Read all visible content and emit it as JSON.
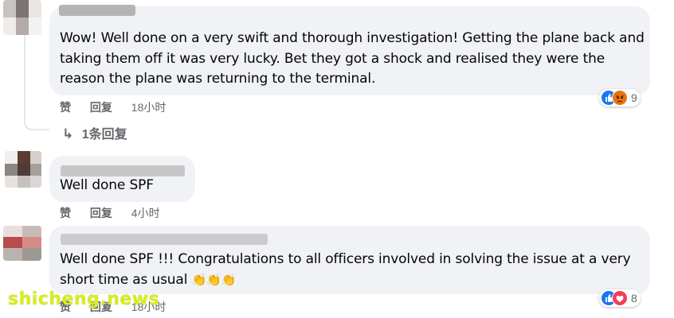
{
  "colors": {
    "bubble": "#f0f2f5",
    "meta_text": "#65676b",
    "like_blue": "#1877f2",
    "love_red": "#f33e58",
    "angry_orange": "#e9710f",
    "watermark": "#d8ee1c"
  },
  "comments": [
    {
      "avatar_icon": "blurred-avatar",
      "text_lines": [
        "Wow! Well done on a very swift and thorough investigation! Getting the plane back and",
        "taking them off it was very lucky. Bet they got a shock and realised they were the",
        "reason the plane was returning to the terminal."
      ],
      "like_label": "赞",
      "reply_label": "回复",
      "time": "18小时",
      "reactions": [
        "like-icon",
        "angry-icon"
      ],
      "reaction_count": "9",
      "replies_label": "1条回复"
    },
    {
      "avatar_icon": "blurred-avatar",
      "text_lines": [
        "Well done SPF"
      ],
      "like_label": "赞",
      "reply_label": "回复",
      "time": "4小时"
    },
    {
      "avatar_icon": "blurred-avatar",
      "text_lines": [
        "Well done SPF !!! Congratulations to all officers involved in solving the issue at a very",
        "short time as usual"
      ],
      "emoji": [
        "clapping-hands-icon",
        "clapping-hands-icon",
        "clapping-hands-icon"
      ],
      "like_label": "赞",
      "reply_label": "回复",
      "time": "18小时",
      "reactions": [
        "like-icon",
        "love-icon"
      ],
      "reaction_count": "8"
    }
  ],
  "watermark": "shicheng.news"
}
